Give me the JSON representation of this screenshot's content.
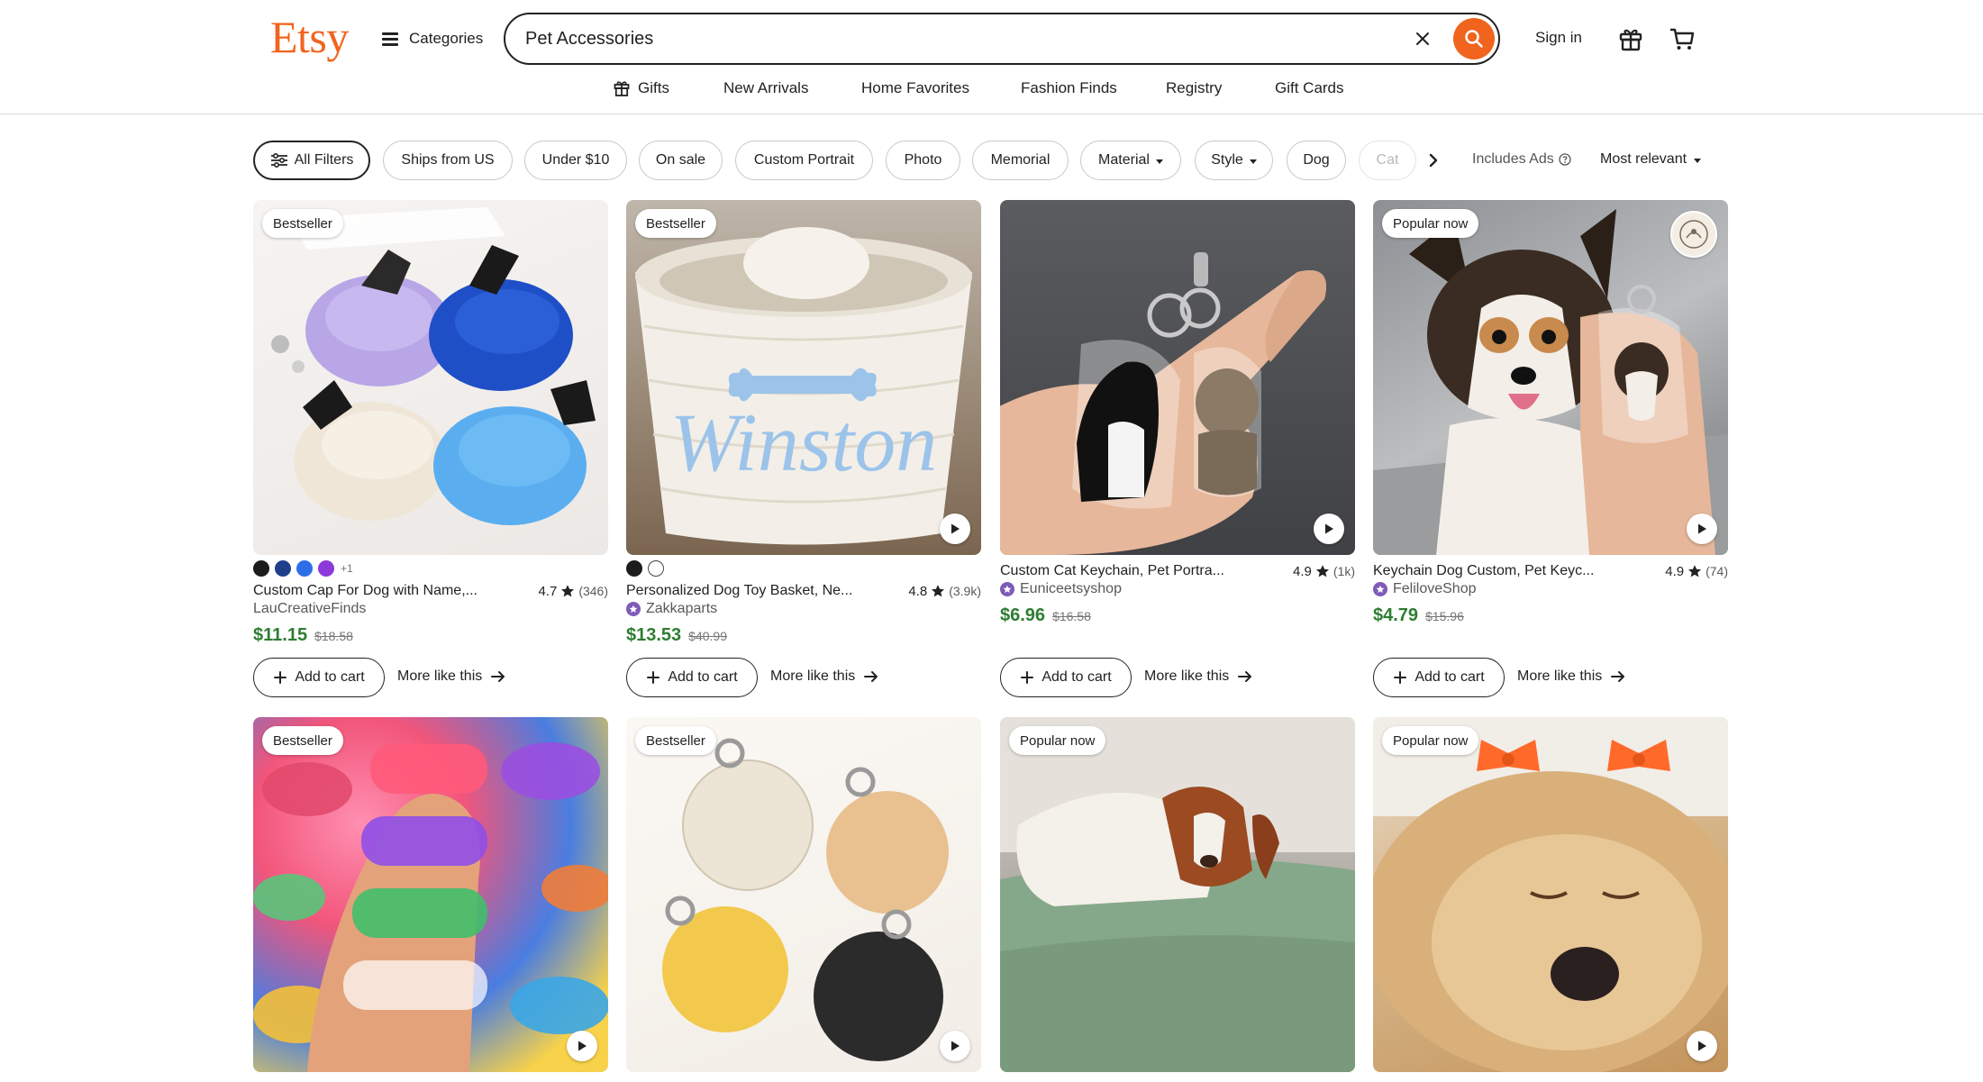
{
  "header": {
    "logo": "Etsy",
    "categories_label": "Categories",
    "search_value": "Pet Accessories",
    "signin_label": "Sign in"
  },
  "subnav": [
    {
      "label": "Gifts",
      "icon": "gift-icon"
    },
    {
      "label": "New Arrivals"
    },
    {
      "label": "Home Favorites"
    },
    {
      "label": "Fashion Finds"
    },
    {
      "label": "Registry"
    },
    {
      "label": "Gift Cards"
    }
  ],
  "filters": {
    "all_filters": "All Filters",
    "pills": [
      "Ships from US",
      "Under $10",
      "On sale",
      "Custom Portrait",
      "Photo",
      "Memorial",
      "Material",
      "Style",
      "Dog",
      "Cat"
    ],
    "includes_ads": "Includes Ads",
    "sort_label": "Most relevant"
  },
  "colors": {
    "brand": "#f1641e",
    "price_green": "#2e7d32",
    "text": "#222222"
  },
  "products": [
    {
      "badge": "Bestseller",
      "title": "Custom Cap For Dog with Name,...",
      "rating": "4.7",
      "reviews": "(346)",
      "shop": "LauCreativeFinds",
      "price": "$11.15",
      "original": "$18.58",
      "swatches": [
        "#1c1c1c",
        "#1e3f8a",
        "#2d6ee8",
        "#8b3ad9"
      ],
      "swatch_more": "+1",
      "play": false,
      "star_seller": false
    },
    {
      "badge": "Bestseller",
      "title": "Personalized Dog Toy Basket, Ne...",
      "rating": "4.8",
      "reviews": "(3.9k)",
      "shop": "Zakkaparts",
      "price": "$13.53",
      "original": "$40.99",
      "swatches": [
        "#1c1c1c",
        "#ffffff"
      ],
      "swatch_more": "",
      "play": true,
      "star_seller": true
    },
    {
      "badge": "",
      "title": "Custom Cat Keychain, Pet Portra...",
      "rating": "4.9",
      "reviews": "(1k)",
      "shop": "Euniceetsyshop",
      "price": "$6.96",
      "original": "$16.58",
      "swatches": [],
      "swatch_more": "",
      "play": true,
      "star_seller": true
    },
    {
      "badge": "Popular now",
      "title": "Keychain Dog Custom, Pet Keyc...",
      "rating": "4.9",
      "reviews": "(74)",
      "shop": "FeliloveShop",
      "price": "$4.79",
      "original": "$15.96",
      "swatches": [],
      "swatch_more": "",
      "play": true,
      "star_seller": true
    },
    {
      "badge": "Bestseller",
      "play": true
    },
    {
      "badge": "Bestseller",
      "play": true
    },
    {
      "badge": "Popular now",
      "play": false
    },
    {
      "badge": "Popular now",
      "play": true
    }
  ],
  "card_actions": {
    "add_to_cart": "Add to cart",
    "more_like_this": "More like this"
  }
}
